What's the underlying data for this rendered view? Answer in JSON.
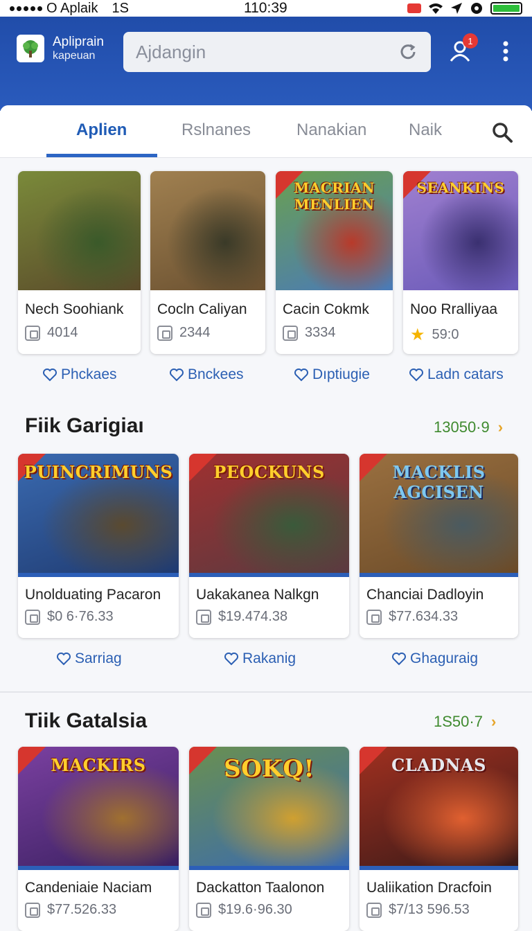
{
  "status": {
    "carrier": "O Aplaik",
    "network": "1S",
    "time": "110:39"
  },
  "brand": {
    "line1": "Apliprain",
    "line2": "kapeuan"
  },
  "search": {
    "placeholder": "Ajdangin"
  },
  "notifications": {
    "count": "1"
  },
  "tabs": [
    {
      "label": "Aplien",
      "active": true
    },
    {
      "label": "Rslnanes",
      "active": false
    },
    {
      "label": "Nanakian",
      "active": false
    },
    {
      "label": "Naik",
      "active": false
    }
  ],
  "featured": [
    {
      "name": "Nech Soohiank",
      "meta": "4014",
      "meta_icon": "box-icon",
      "action": "Phckaes",
      "art_title": "",
      "colors": [
        "#5a4a2a",
        "#7a8a3a",
        "#3a5a2a"
      ]
    },
    {
      "name": "Cocln Caliyan",
      "meta": "2344",
      "meta_icon": "box-icon",
      "action": "Bnckees",
      "art_title": "",
      "colors": [
        "#6a5030",
        "#a08050",
        "#3a3a28"
      ]
    },
    {
      "name": "Cacin Cokmk",
      "meta": "3334",
      "meta_icon": "box-icon",
      "action": "Dıptiugie",
      "art_title": "MACRIAN MENLIEN",
      "colors": [
        "#4a7ab8",
        "#6aa050",
        "#b83a2a"
      ]
    },
    {
      "name": "Noo Rralliyaa",
      "meta": "59:0",
      "meta_icon": "star-icon",
      "action": "Ladn catars",
      "art_title": "SEANKINS",
      "colors": [
        "#6a5ab8",
        "#a080d0",
        "#3a3070"
      ]
    }
  ],
  "section1": {
    "title": "Fiik Garigiaı",
    "count": "13050·9",
    "cards": [
      {
        "name": "Unolduating Pacaron",
        "price": "$0 6·76.33",
        "action": "Sarriag",
        "art_title": "PUINCRIMUNS",
        "colors": [
          "#1f3a70",
          "#3a6ab0",
          "#5a4a30"
        ]
      },
      {
        "name": "Uakakanea Nalkgn",
        "price": "$19.474.38",
        "action": "Rakanig",
        "art_title": "PEOCKUNS",
        "colors": [
          "#5a3a40",
          "#a03030",
          "#3a5a3a"
        ]
      },
      {
        "name": "Chanciai Dadloyin",
        "price": "$77.634.33",
        "action": "Ghaguraig",
        "art_title": "MACKLIS AGCISEN",
        "colors": [
          "#6a4a28",
          "#9a7040",
          "#4a5a60"
        ]
      }
    ]
  },
  "section2": {
    "title": "Tiik Gatalsia",
    "count": "1S50·7",
    "cards": [
      {
        "name": "Candeniaie Naciam",
        "price": "$77.526.33",
        "art_title": "MACKIRS",
        "colors": [
          "#3a2060",
          "#7a40a0",
          "#a07030"
        ]
      },
      {
        "name": "Dackatton Taalonon",
        "price": "$19.6·96.30",
        "art_title": "SOKQ!",
        "colors": [
          "#3a6ab0",
          "#6a9050",
          "#d0a030"
        ]
      },
      {
        "name": "Ualiikation Dracfoin",
        "price": "$7/13 596.53",
        "art_title": "CLADNAS",
        "colors": [
          "#3a1a18",
          "#a03020",
          "#e06030"
        ]
      }
    ]
  }
}
